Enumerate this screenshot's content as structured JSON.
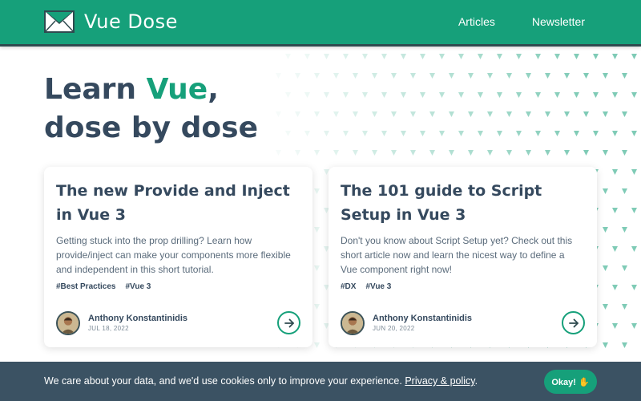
{
  "header": {
    "brand_left": "Vue",
    "brand_right": "Dose",
    "nav": [
      "Articles",
      "Newsletter"
    ]
  },
  "hero": {
    "line1_prefix": "Learn ",
    "line1_accent": "Vue",
    "line1_suffix": ",",
    "line2": "dose by dose"
  },
  "cards": [
    {
      "title": "The new Provide and Inject in Vue 3",
      "description": "Getting stuck into the prop drilling? Learn how provide/inject can make your components more flexible and independent in this short tutorial.",
      "tags": [
        "#Best Practices",
        "#Vue 3"
      ],
      "author": "Anthony Konstantinidis",
      "date": "JUL 18, 2022"
    },
    {
      "title": "The 101 guide to Script Setup in Vue 3",
      "description": "Don't you know about Script Setup yet? Check out this short article now and learn the nicest way to define a Vue component right now!",
      "tags": [
        "#DX",
        "#Vue 3"
      ],
      "author": "Anthony Konstantinidis",
      "date": "JUN 20, 2022"
    }
  ],
  "cookie": {
    "text": "We care about your data, and we'd use cookies only to improve your experience. ",
    "link": "Privacy & policy",
    "after_link": ".",
    "button": "Okay! ✋"
  },
  "colors": {
    "brand": "#16a07a",
    "text": "#35495e",
    "cookie_bg": "#3b5263"
  },
  "icons": [
    "envelope-logo-icon",
    "arrow-right-icon",
    "avatar"
  ]
}
